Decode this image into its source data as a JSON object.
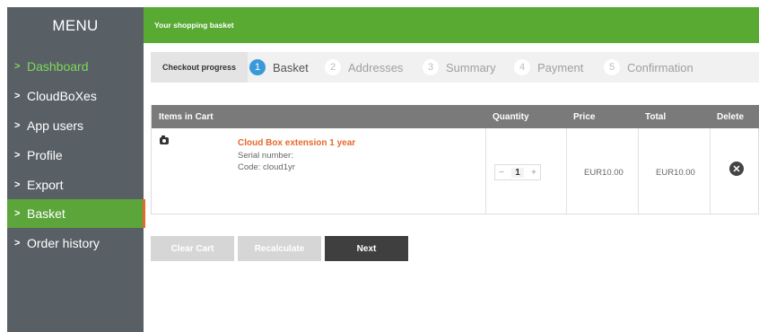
{
  "sidebar": {
    "title": "MENU",
    "items": [
      {
        "label": "Dashboard",
        "state": "green"
      },
      {
        "label": "CloudBoXes",
        "state": "normal"
      },
      {
        "label": "App users",
        "state": "normal"
      },
      {
        "label": "Profile",
        "state": "normal"
      },
      {
        "label": "Export",
        "state": "normal"
      },
      {
        "label": "Basket",
        "state": "active"
      },
      {
        "label": "Order history",
        "state": "normal"
      }
    ]
  },
  "header": {
    "title": "Your shopping basket"
  },
  "progress": {
    "label": "Checkout progress",
    "steps": [
      {
        "num": "1",
        "label": "Basket",
        "active": true
      },
      {
        "num": "2",
        "label": "Addresses",
        "active": false
      },
      {
        "num": "3",
        "label": "Summary",
        "active": false
      },
      {
        "num": "4",
        "label": "Payment",
        "active": false
      },
      {
        "num": "5",
        "label": "Confirmation",
        "active": false
      }
    ]
  },
  "cart": {
    "headers": {
      "items": "Items in Cart",
      "quantity": "Quantity",
      "price": "Price",
      "total": "Total",
      "delete": "Delete"
    },
    "rows": [
      {
        "name": "Cloud Box extension  1 year",
        "serial": "Serial number:",
        "code": "Code: cloud1yr",
        "qty_minus": "−",
        "qty": "1",
        "qty_plus": "+",
        "price": "EUR10.00",
        "total": "EUR10.00",
        "delete_icon": "✕"
      }
    ]
  },
  "buttons": {
    "clear": "Clear Cart",
    "recalculate": "Recalculate",
    "next": "Next"
  },
  "colors": {
    "sidebar_bg": "#586066",
    "header_green": "#58aa33",
    "active_nav": "#5ba53a",
    "accent_orange": "#e8682a",
    "step_active": "#3a9ad9"
  }
}
